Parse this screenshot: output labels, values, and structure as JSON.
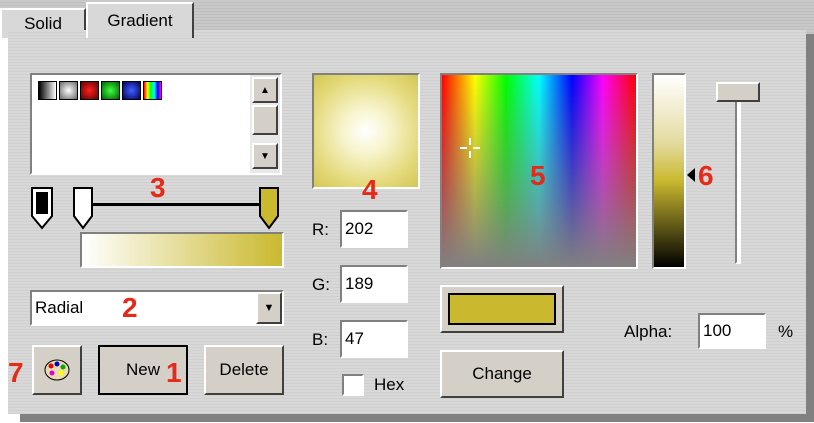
{
  "tabs": [
    {
      "label": "Solid",
      "active": false
    },
    {
      "label": "Gradient",
      "active": true
    }
  ],
  "preset_swatches": [
    {
      "name": "black-white"
    },
    {
      "name": "gray-radial"
    },
    {
      "name": "red"
    },
    {
      "name": "green"
    },
    {
      "name": "blue"
    },
    {
      "name": "rainbow"
    }
  ],
  "gradient_type": {
    "selected": "Radial"
  },
  "buttons": {
    "new": "New",
    "delete": "Delete",
    "change": "Change"
  },
  "rgb": {
    "r_label": "R:",
    "r_value": "202",
    "g_label": "G:",
    "g_value": "189",
    "b_label": "B:",
    "b_value": "47",
    "hex_label": "Hex",
    "hex_checked": false
  },
  "alpha": {
    "label": "Alpha:",
    "value": "100",
    "unit": "%"
  },
  "current_color": "#cab92f",
  "annotations": {
    "n1": "1",
    "n2": "2",
    "n3": "3",
    "n4": "4",
    "n5": "5",
    "n6": "6",
    "n7": "7"
  }
}
